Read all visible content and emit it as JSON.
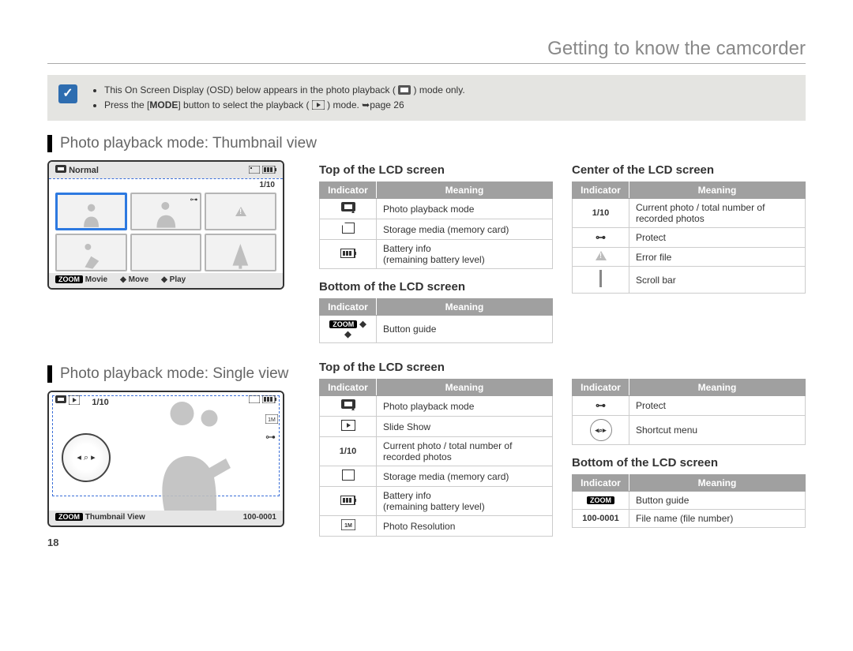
{
  "page_title": "Getting to know the camcorder",
  "page_number": "18",
  "note": {
    "bullet1_a": "This On Screen Display (OSD) below appears in the photo playback (",
    "bullet1_b": " ) mode only.",
    "bullet2_a": "Press the [",
    "bullet2_mode": "MODE",
    "bullet2_b": "] button to select the playback (",
    "bullet2_c": ") mode. ",
    "bullet2_arrow": "➥",
    "bullet2_page": "page 26"
  },
  "section1_heading": "Photo playback mode: Thumbnail view",
  "section2_heading": "Photo playback mode: Single view",
  "lcd_thumb": {
    "normal_label": "Normal",
    "counter": "1/10",
    "zoom": "ZOOM",
    "movie": "Movie",
    "move": "Move",
    "play": "Play"
  },
  "lcd_single": {
    "counter": "1/10",
    "zoom": "ZOOM",
    "thumb_view": "Thumbnail View",
    "filenum": "100-0001"
  },
  "tables": {
    "th_indicator": "Indicator",
    "th_meaning": "Meaning",
    "top1": {
      "heading": "Top of the LCD screen",
      "rows": [
        {
          "icon": "photo-mode",
          "meaning": "Photo playback mode"
        },
        {
          "icon": "card",
          "meaning": "Storage media (memory card)"
        },
        {
          "icon": "battery",
          "meaning": "Battery info\n(remaining battery level)"
        }
      ]
    },
    "bottom1": {
      "heading": "Bottom of the LCD screen",
      "rows": [
        {
          "icon": "button-guide",
          "meaning": "Button guide"
        }
      ]
    },
    "center1": {
      "heading": "Center of the LCD screen",
      "rows": [
        {
          "icon": "1/10",
          "meaning": "Current photo / total number of recorded photos"
        },
        {
          "icon": "protect",
          "meaning": "Protect"
        },
        {
          "icon": "error",
          "meaning": "Error file"
        },
        {
          "icon": "scrollbar",
          "meaning": "Scroll bar"
        }
      ]
    },
    "top2": {
      "heading": "Top of the LCD screen",
      "rows": [
        {
          "icon": "photo-mode",
          "meaning": "Photo playback mode"
        },
        {
          "icon": "slideshow",
          "meaning": "Slide Show"
        },
        {
          "icon": "1/10",
          "meaning": "Current photo / total number of recorded photos"
        },
        {
          "icon": "card",
          "meaning": "Storage media (memory card)"
        },
        {
          "icon": "battery",
          "meaning": "Battery info\n(remaining battery level)"
        },
        {
          "icon": "resolution",
          "meaning": "Photo Resolution"
        }
      ]
    },
    "top2_right": {
      "rows": [
        {
          "icon": "protect",
          "meaning": "Protect"
        },
        {
          "icon": "shortcut",
          "meaning": "Shortcut menu"
        }
      ]
    },
    "bottom2": {
      "heading": "Bottom of the LCD screen",
      "rows": [
        {
          "icon": "ZOOM",
          "meaning": "Button guide"
        },
        {
          "icon": "100-0001",
          "meaning": "File name (file number)"
        }
      ]
    }
  }
}
